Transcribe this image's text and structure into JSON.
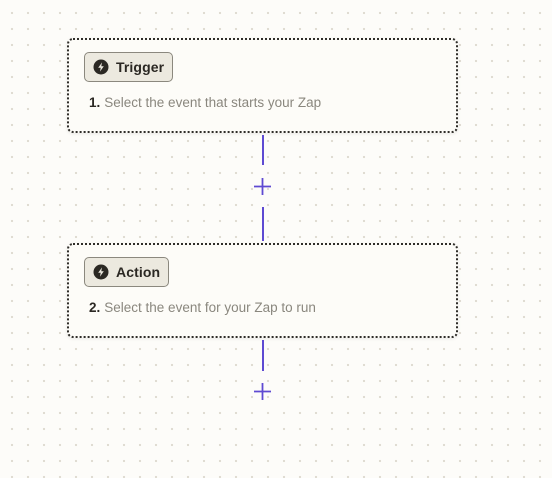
{
  "steps": [
    {
      "type_label": "Trigger",
      "number": "1.",
      "description": "Select the event that starts your Zap",
      "icon": "lightning-bolt-icon"
    },
    {
      "type_label": "Action",
      "number": "2.",
      "description": "Select the event for your Zap to run",
      "icon": "lightning-bolt-icon"
    }
  ],
  "add_step_icon": "plus-icon",
  "colors": {
    "connector": "#5e4ad2",
    "card_border": "#2f2d29",
    "badge_bg": "#ece9df",
    "description_text": "#8a877e",
    "canvas_bg": "#fdfcf9"
  }
}
